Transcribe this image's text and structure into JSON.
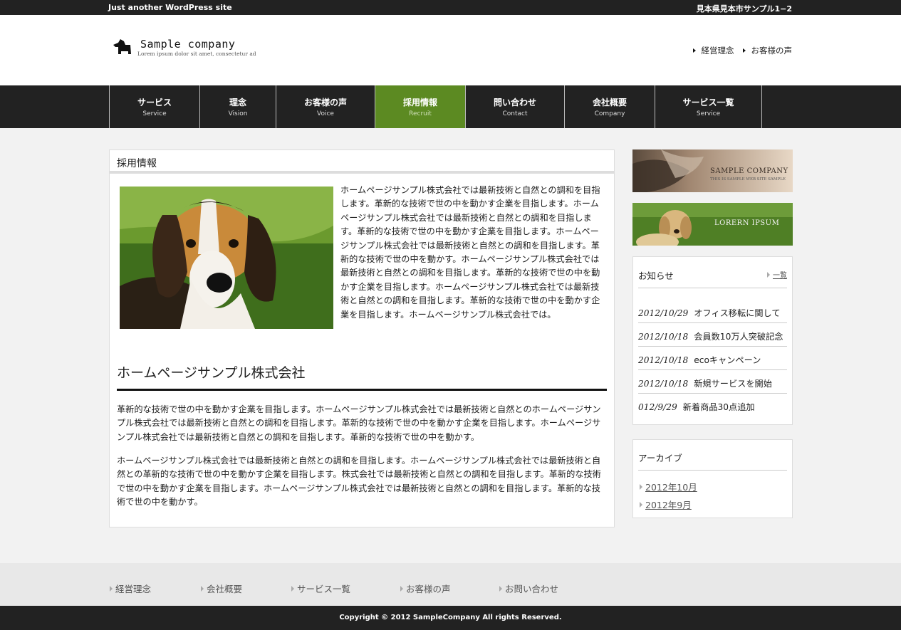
{
  "topbar": {
    "tagline": "Just another WordPress site",
    "address": "見本県見本市サンプル1−2"
  },
  "header": {
    "logo_name": "Sample company",
    "logo_sub": "Lorem ipsum dolor sit amet, consectetur ad",
    "links": [
      {
        "label": "経営理念"
      },
      {
        "label": "お客様の声"
      }
    ]
  },
  "nav": [
    {
      "jp": "サービス",
      "en": "Service",
      "active": false
    },
    {
      "jp": "理念",
      "en": "Vision",
      "active": false
    },
    {
      "jp": "お客様の声",
      "en": "Voice",
      "active": false
    },
    {
      "jp": "採用情報",
      "en": "Recruit",
      "active": true
    },
    {
      "jp": "問い合わせ",
      "en": "Contact",
      "active": false
    },
    {
      "jp": "会社概要",
      "en": "Company",
      "active": false
    },
    {
      "jp": "サービス一覧",
      "en": "Service",
      "active": false
    }
  ],
  "main": {
    "title": "採用情報",
    "intro": "ホームページサンプル株式会社では最新技術と自然との調和を目指します。革新的な技術で世の中を動かす企業を目指します。ホームページサンプル株式会社では最新技術と自然との調和を目指します。革新的な技術で世の中を動かす企業を目指します。ホームページサンプル株式会社では最新技術と自然との調和を目指します。革新的な技術で世の中を動かす。ホームページサンプル株式会社では最新技術と自然との調和を目指します。革新的な技術で世の中を動かす企業を目指します。ホームページサンプル株式会社では最新技術と自然との調和を目指します。革新的な技術で世の中を動かす企業を目指します。ホームページサンプル株式会社では。",
    "heading": "ホームページサンプル株式会社",
    "para1": "革新的な技術で世の中を動かす企業を目指します。ホームページサンプル株式会社では最新技術と自然とのホームページサンプル株式会社では最新技術と自然との調和を目指します。革新的な技術で世の中を動かす企業を目指します。ホームページサンプル株式会社では最新技術と自然との調和を目指します。革新的な技術で世の中を動かす。",
    "para2": "ホームページサンプル株式会社では最新技術と自然との調和を目指します。ホームページサンプル株式会社では最新技術と自然との革新的な技術で世の中を動かす企業を目指します。株式会社では最新技術と自然との調和を目指します。革新的な技術で世の中を動かす企業を目指します。ホームページサンプル株式会社では最新技術と自然との調和を目指します。革新的な技術で世の中を動かす。"
  },
  "sidebar": {
    "banner1": {
      "title": "SAMPLE COMPANY",
      "sub": "THIS IS SAMPLE WEB SITE SAMPLE"
    },
    "banner2": {
      "title": "LORERN IPSUM"
    },
    "news": {
      "title": "お知らせ",
      "more": "一覧",
      "items": [
        {
          "date": "2012/10/29",
          "text": "オフィス移転に関して"
        },
        {
          "date": "2012/10/18",
          "text": "会員数10万人突破記念"
        },
        {
          "date": "2012/10/18",
          "text": "ecoキャンペーン"
        },
        {
          "date": "2012/10/18",
          "text": "新規サービスを開始"
        },
        {
          "date": "012/9/29",
          "text": "新着商品30点追加"
        }
      ]
    },
    "archive": {
      "title": "アーカイブ",
      "items": [
        {
          "label": "2012年10月"
        },
        {
          "label": "2012年9月"
        }
      ]
    }
  },
  "footer": {
    "links": [
      {
        "label": "経営理念"
      },
      {
        "label": "会社概要"
      },
      {
        "label": "サービス一覧"
      },
      {
        "label": "お客様の声"
      },
      {
        "label": "お問い合わせ"
      }
    ],
    "copyright": "Copyright © 2012 SampleCompany All rights Reserved."
  },
  "colors": {
    "nav_bg": "#222222",
    "nav_active": "#5c8a22",
    "page_bg": "#f2f2f2"
  },
  "icons": {
    "link_bullet": "triangle-right-icon",
    "logo": "dog-logo-icon"
  }
}
